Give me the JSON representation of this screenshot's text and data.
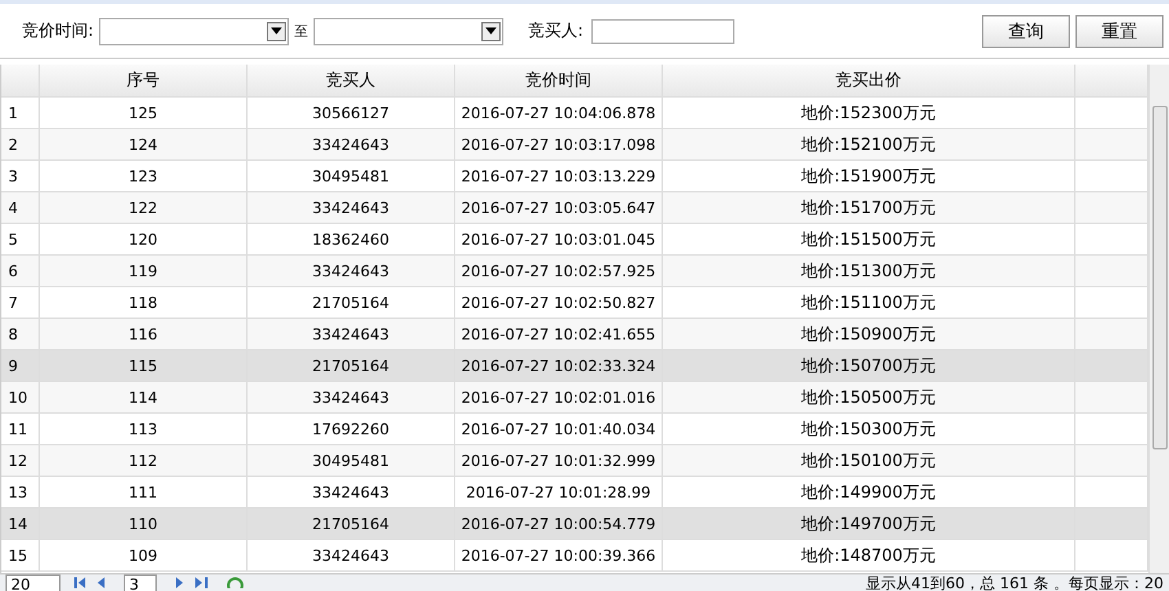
{
  "filter": {
    "time_label": "竞价时间:",
    "separator": "至",
    "bidder_label": "竞买人:",
    "buttons": [
      "查询",
      "重置"
    ]
  },
  "table": {
    "columns": [
      "序号",
      "竞买人",
      "竞价时间",
      "竞买出价"
    ],
    "rows": [
      {
        "num": "1",
        "cells": [
          "125",
          "30566127",
          "2016-07-27 10:04:06.878",
          "地价:152300万元"
        ],
        "selected": false
      },
      {
        "num": "2",
        "cells": [
          "124",
          "33424643",
          "2016-07-27 10:03:17.098",
          "地价:152100万元"
        ],
        "selected": false
      },
      {
        "num": "3",
        "cells": [
          "123",
          "30495481",
          "2016-07-27 10:03:13.229",
          "地价:151900万元"
        ],
        "selected": false
      },
      {
        "num": "4",
        "cells": [
          "122",
          "33424643",
          "2016-07-27 10:03:05.647",
          "地价:151700万元"
        ],
        "selected": false
      },
      {
        "num": "5",
        "cells": [
          "120",
          "18362460",
          "2016-07-27 10:03:01.045",
          "地价:151500万元"
        ],
        "selected": false
      },
      {
        "num": "6",
        "cells": [
          "119",
          "33424643",
          "2016-07-27 10:02:57.925",
          "地价:151300万元"
        ],
        "selected": false
      },
      {
        "num": "7",
        "cells": [
          "118",
          "21705164",
          "2016-07-27 10:02:50.827",
          "地价:151100万元"
        ],
        "selected": false
      },
      {
        "num": "8",
        "cells": [
          "116",
          "33424643",
          "2016-07-27 10:02:41.655",
          "地价:150900万元"
        ],
        "selected": false
      },
      {
        "num": "9",
        "cells": [
          "115",
          "21705164",
          "2016-07-27 10:02:33.324",
          "地价:150700万元"
        ],
        "selected": true
      },
      {
        "num": "10",
        "cells": [
          "114",
          "33424643",
          "2016-07-27 10:02:01.016",
          "地价:150500万元"
        ],
        "selected": false
      },
      {
        "num": "11",
        "cells": [
          "113",
          "17692260",
          "2016-07-27 10:01:40.034",
          "地价:150300万元"
        ],
        "selected": false
      },
      {
        "num": "12",
        "cells": [
          "112",
          "30495481",
          "2016-07-27 10:01:32.999",
          "地价:150100万元"
        ],
        "selected": false
      },
      {
        "num": "13",
        "cells": [
          "111",
          "33424643",
          "2016-07-27 10:01:28.99",
          "地价:149900万元"
        ],
        "selected": false
      },
      {
        "num": "14",
        "cells": [
          "110",
          "21705164",
          "2016-07-27 10:00:54.779",
          "地价:149700万元"
        ],
        "selected": true
      },
      {
        "num": "15",
        "cells": [
          "109",
          "33424643",
          "2016-07-27 10:00:39.366",
          "地价:148700万元"
        ],
        "selected": false
      }
    ]
  },
  "pager": {
    "page_size": "20",
    "page": "3",
    "status": "显示从41到60，总 161 条 。每页显示：20"
  }
}
